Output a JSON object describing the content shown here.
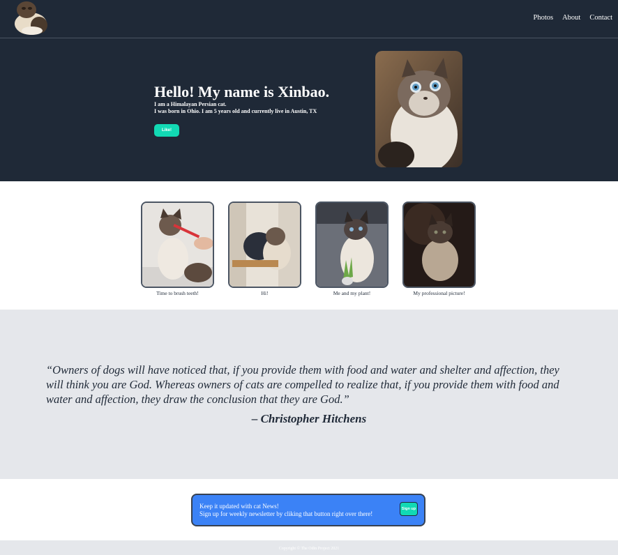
{
  "nav": {
    "items": [
      {
        "label": "Photos"
      },
      {
        "label": "About"
      },
      {
        "label": "Contact"
      }
    ]
  },
  "hero": {
    "title": "Hello! My name is Xinbao.",
    "line1": "I am a Himalayan Persian cat.",
    "line2": "I was born in Ohio. I am 5 years old and currently live in Austin, TX",
    "like_label": "Like!"
  },
  "gallery": {
    "cards": [
      {
        "caption": "Time to brush teeth!"
      },
      {
        "caption": "Hi!"
      },
      {
        "caption": "Me and my plant!"
      },
      {
        "caption": "My professional picture!"
      }
    ]
  },
  "quote": {
    "text": "“Owners of dogs will have noticed that, if you provide them with food and water and shelter and affection, they will think you are God. Whereas owners of cats are compelled to realize that, if you provide them with food and water and affection, they draw the conclusion that they are God.”",
    "author": "– Christopher Hitchens"
  },
  "newsletter": {
    "line1": "Keep it updated with cat News!",
    "line2": "Sign up for weekly newsletter by cliking that button right over there!",
    "signup_label": "Sign up"
  },
  "footer": {
    "copyright": "Copyright © The Odin Project 2021"
  },
  "colors": {
    "dark": "#1f2937",
    "accent": "#12d9b4",
    "blue": "#3b82f6",
    "gray": "#e5e7eb"
  },
  "icons": {
    "logo": "cat-logo-image",
    "hero_photo": "cat-portrait-image"
  }
}
